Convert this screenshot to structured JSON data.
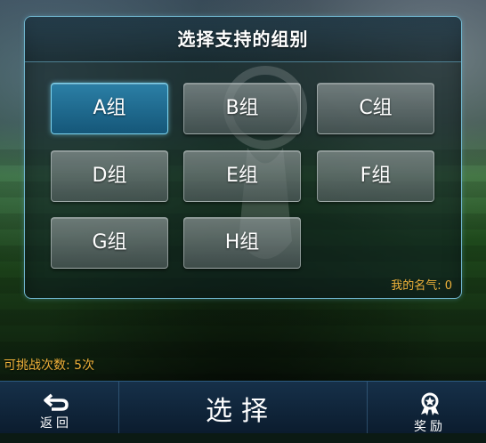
{
  "dialog": {
    "title": "选择支持的组别",
    "groups": [
      {
        "label": "A组",
        "selected": true
      },
      {
        "label": "B组",
        "selected": false
      },
      {
        "label": "C组",
        "selected": false
      },
      {
        "label": "D组",
        "selected": false
      },
      {
        "label": "E组",
        "selected": false
      },
      {
        "label": "F组",
        "selected": false
      },
      {
        "label": "G组",
        "selected": false
      },
      {
        "label": "H组",
        "selected": false
      }
    ],
    "fame_text": "我的名气: 0"
  },
  "challenge_text": "可挑战次数: 5次",
  "bottom_bar": {
    "back_label": "返回",
    "title": "选择",
    "reward_label": "奖励",
    "back_icon": "back-arrow-icon",
    "reward_icon": "reward-medal-icon"
  },
  "colors": {
    "accent": "#2b7fa6",
    "frame": "#6fb4cc",
    "highlight_text": "#f0b23a",
    "bar_bg": "#0b1c2e"
  }
}
